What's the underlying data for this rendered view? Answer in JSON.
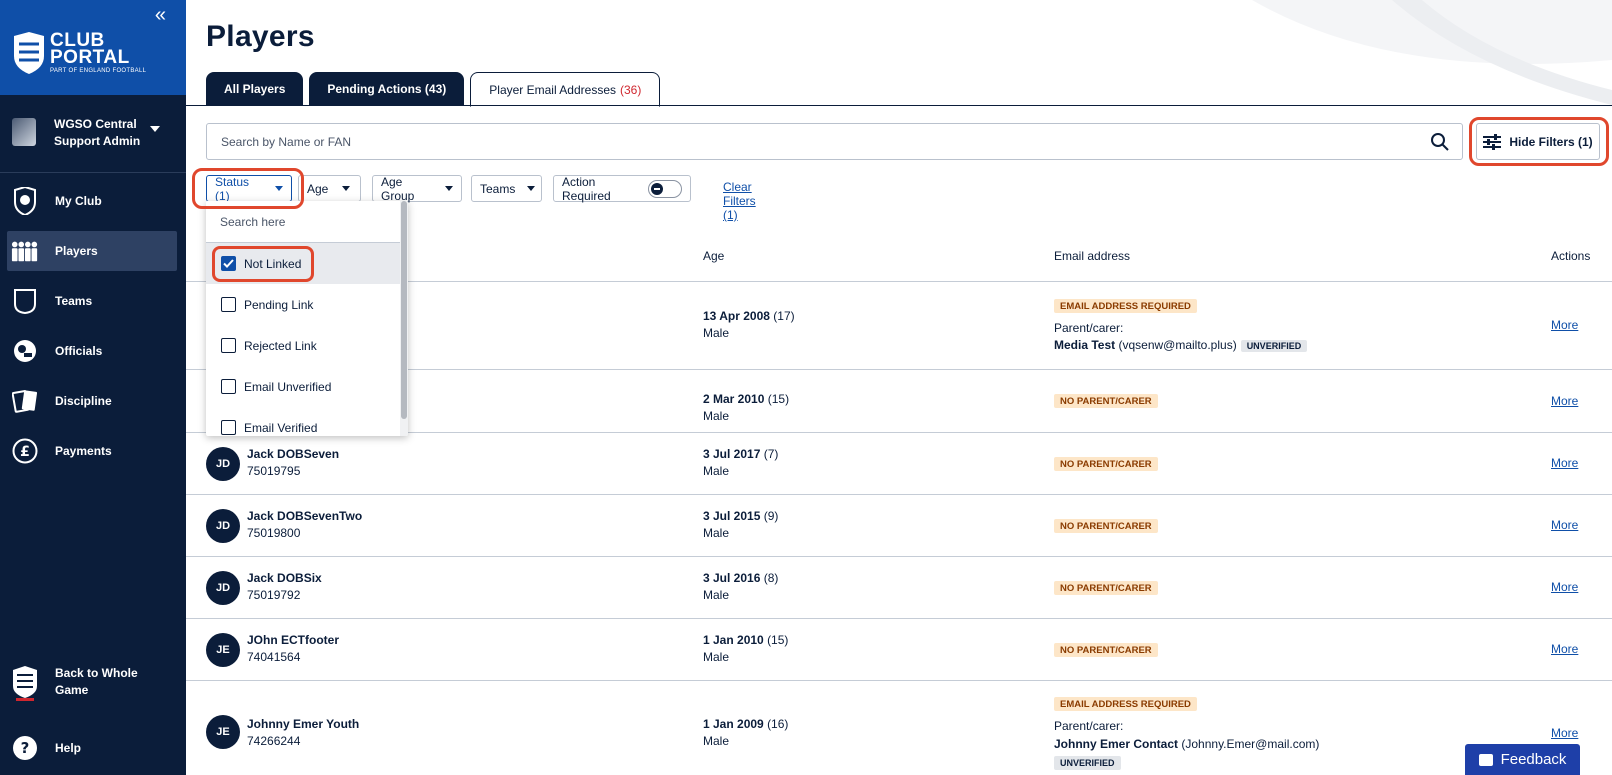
{
  "app": {
    "logo_line1": "CLUB",
    "logo_line2": "PORTAL",
    "logo_sub": "PART OF ENGLAND FOOTBALL",
    "collapse_glyph": "«"
  },
  "user": {
    "name_line1": "WGSO Central",
    "name_line2": "Support Admin"
  },
  "sidebar": {
    "items": [
      {
        "label": "My Club",
        "icon": "club-badge-icon"
      },
      {
        "label": "Players",
        "icon": "players-icon",
        "active": true
      },
      {
        "label": "Teams",
        "icon": "shirt-icon"
      },
      {
        "label": "Officials",
        "icon": "whistle-icon"
      },
      {
        "label": "Discipline",
        "icon": "cards-icon"
      },
      {
        "label": "Payments",
        "icon": "pound-icon"
      }
    ],
    "back_label": "Back to Whole Game",
    "back_badge": "The FA",
    "help_label": "Help"
  },
  "page": {
    "title": "Players",
    "tabs": [
      {
        "label": "All Players"
      },
      {
        "label": "Pending Actions (43)"
      },
      {
        "label": "Player Email Addresses",
        "count": "(36)",
        "active": true
      }
    ]
  },
  "search": {
    "placeholder": "Search by Name or FAN",
    "hide_filters_label": "Hide Filters (1)"
  },
  "filters": {
    "status": "Status (1)",
    "age": "Age",
    "age_group": "Age Group",
    "teams": "Teams",
    "action_required": "Action Required",
    "clear": "Clear Filters (1)"
  },
  "status_dropdown": {
    "search_placeholder": "Search here",
    "options": [
      {
        "label": "Not Linked",
        "checked": true
      },
      {
        "label": "Pending Link",
        "checked": false
      },
      {
        "label": "Rejected Link",
        "checked": false
      },
      {
        "label": "Email Unverified",
        "checked": false
      },
      {
        "label": "Email Verified",
        "checked": false
      }
    ]
  },
  "table": {
    "headers": {
      "age": "Age",
      "email": "Email address",
      "actions": "Actions"
    },
    "rows": [
      {
        "initials": "",
        "name": "",
        "fan": "",
        "dob": "13 Apr 2008",
        "age": "(17)",
        "gender": "Male",
        "badge": "EMAIL ADDRESS REQUIRED",
        "parent_label": "Parent/carer:",
        "parent_name": "Media Test",
        "parent_email": "(vqsenw@mailto.plus)",
        "verified": "UNVERIFIED",
        "action": "More"
      },
      {
        "initials": "",
        "name": "",
        "fan": "",
        "dob": "2 Mar 2010",
        "age": "(15)",
        "gender": "Male",
        "badge": "NO PARENT/CARER",
        "action": "More"
      },
      {
        "initials": "JD",
        "name": "Jack DOBSeven",
        "fan": "75019795",
        "dob": "3 Jul 2017",
        "age": "(7)",
        "gender": "Male",
        "badge": "NO PARENT/CARER",
        "action": "More"
      },
      {
        "initials": "JD",
        "name": "Jack DOBSevenTwo",
        "fan": "75019800",
        "dob": "3 Jul 2015",
        "age": "(9)",
        "gender": "Male",
        "badge": "NO PARENT/CARER",
        "action": "More"
      },
      {
        "initials": "JD",
        "name": "Jack DOBSix",
        "fan": "75019792",
        "dob": "3 Jul 2016",
        "age": "(8)",
        "gender": "Male",
        "badge": "NO PARENT/CARER",
        "action": "More"
      },
      {
        "initials": "JE",
        "name": "JOhn ECTfooter",
        "fan": "74041564",
        "dob": "1 Jan 2010",
        "age": "(15)",
        "gender": "Male",
        "badge": "NO PARENT/CARER",
        "action": "More"
      },
      {
        "initials": "JE",
        "name": "Johnny Emer Youth",
        "fan": "74266244",
        "dob": "1 Jan 2009",
        "age": "(16)",
        "gender": "Male",
        "badge": "EMAIL ADDRESS REQUIRED",
        "parent_label": "Parent/carer:",
        "parent_name": "Johnny Emer Contact",
        "parent_email": "(Johnny.Emer@mail.com)",
        "verified": "UNVERIFIED",
        "action": "More"
      }
    ]
  },
  "feedback": {
    "label": "Feedback"
  },
  "colors": {
    "navy": "#0b1d3a",
    "brand_blue": "#0f4fa8",
    "highlight": "#e0472d",
    "badge_bg": "#fde6c8"
  }
}
